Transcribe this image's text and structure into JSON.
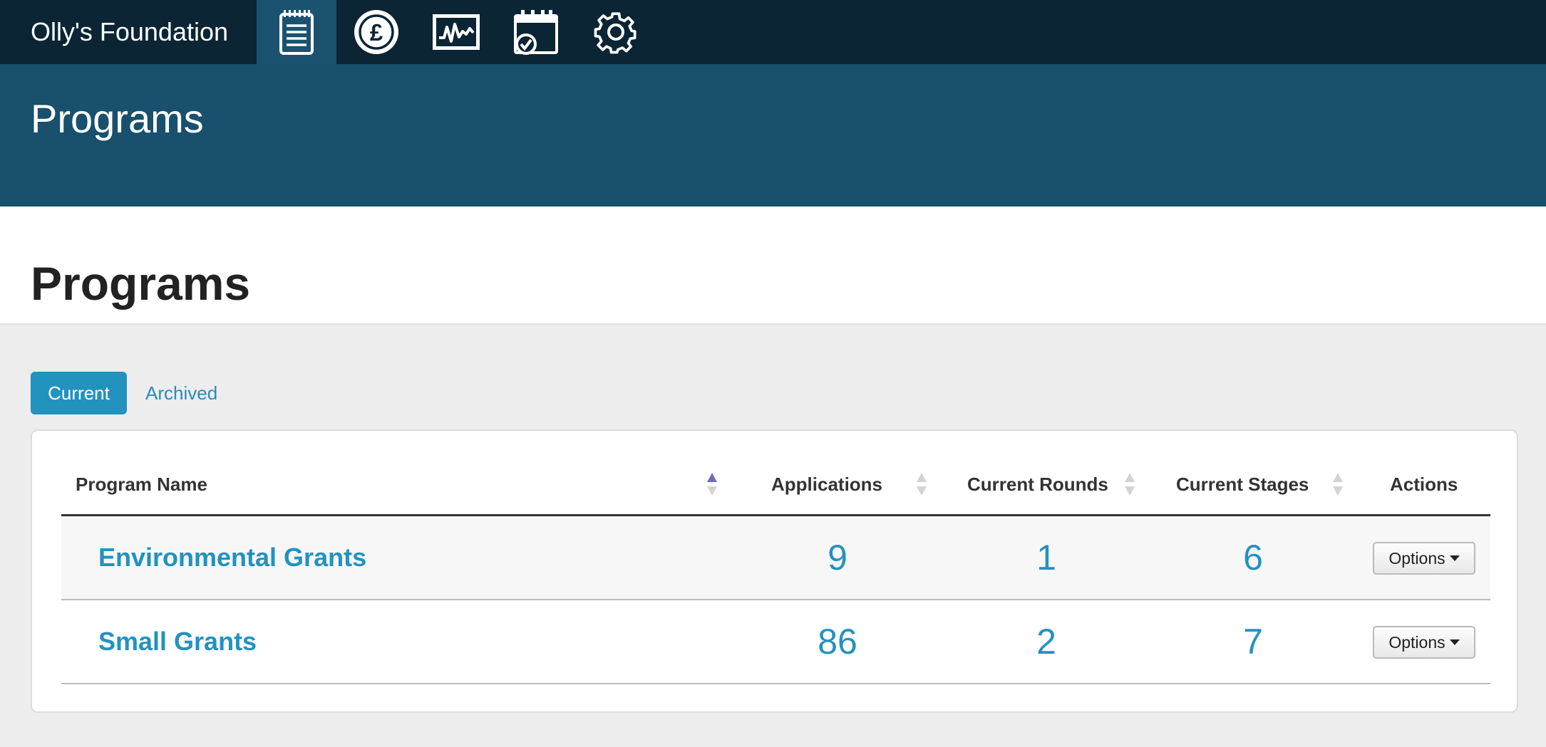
{
  "topbar": {
    "brand": "Olly's Foundation",
    "icons": [
      "clipboard-icon",
      "pound-coin-icon",
      "activity-chart-icon",
      "calendar-check-icon",
      "gear-icon"
    ],
    "colors": {
      "background": "#0b2535",
      "active": "#1a5270"
    }
  },
  "banner": {
    "title": "Programs",
    "color": "#18506d"
  },
  "page": {
    "title": "Programs"
  },
  "tabs": [
    {
      "label": "Current",
      "active": true
    },
    {
      "label": "Archived",
      "active": false
    }
  ],
  "table": {
    "headers": {
      "program_name": "Program Name",
      "applications": "Applications",
      "current_rounds": "Current Rounds",
      "current_stages": "Current Stages",
      "actions": "Actions"
    },
    "rows": [
      {
        "name": "Environmental Grants",
        "applications": "9",
        "current_rounds": "1",
        "current_stages": "6",
        "action_label": "Options"
      },
      {
        "name": "Small Grants",
        "applications": "86",
        "current_rounds": "2",
        "current_stages": "7",
        "action_label": "Options"
      }
    ]
  },
  "colors": {
    "accent": "#2292bf",
    "sort_active": "#6a6fb5",
    "sort_inactive": "#d3d3d3"
  }
}
